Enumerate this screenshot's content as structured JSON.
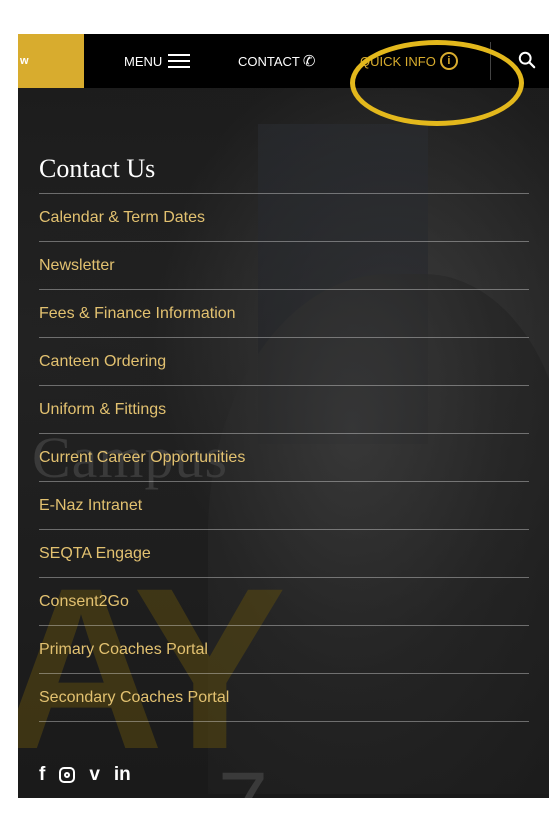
{
  "header": {
    "enrol_label": "w",
    "menu_label": "MENU",
    "contact_label": "CONTACT",
    "contact_icon": "phone-icon",
    "quick_info_label": "QUICK INFO",
    "quick_info_icon": "info-icon",
    "search_icon": "search-icon",
    "accent_color": "#d8ac2e"
  },
  "background": {
    "word": "Campus",
    "letters": "AY",
    "number": "7"
  },
  "panel": {
    "title": "Contact Us",
    "links": [
      "Calendar & Term Dates",
      "Newsletter",
      "Fees & Finance Information",
      "Canteen Ordering",
      "Uniform & Fittings",
      "Current Career Opportunities",
      "E-Naz Intranet",
      "SEQTA Engage",
      "Consent2Go",
      "Primary Coaches Portal",
      "Secondary Coaches Portal"
    ],
    "link_color": "#e2c170"
  },
  "social": {
    "facebook": "f",
    "vimeo": "v",
    "linkedin": "in"
  }
}
